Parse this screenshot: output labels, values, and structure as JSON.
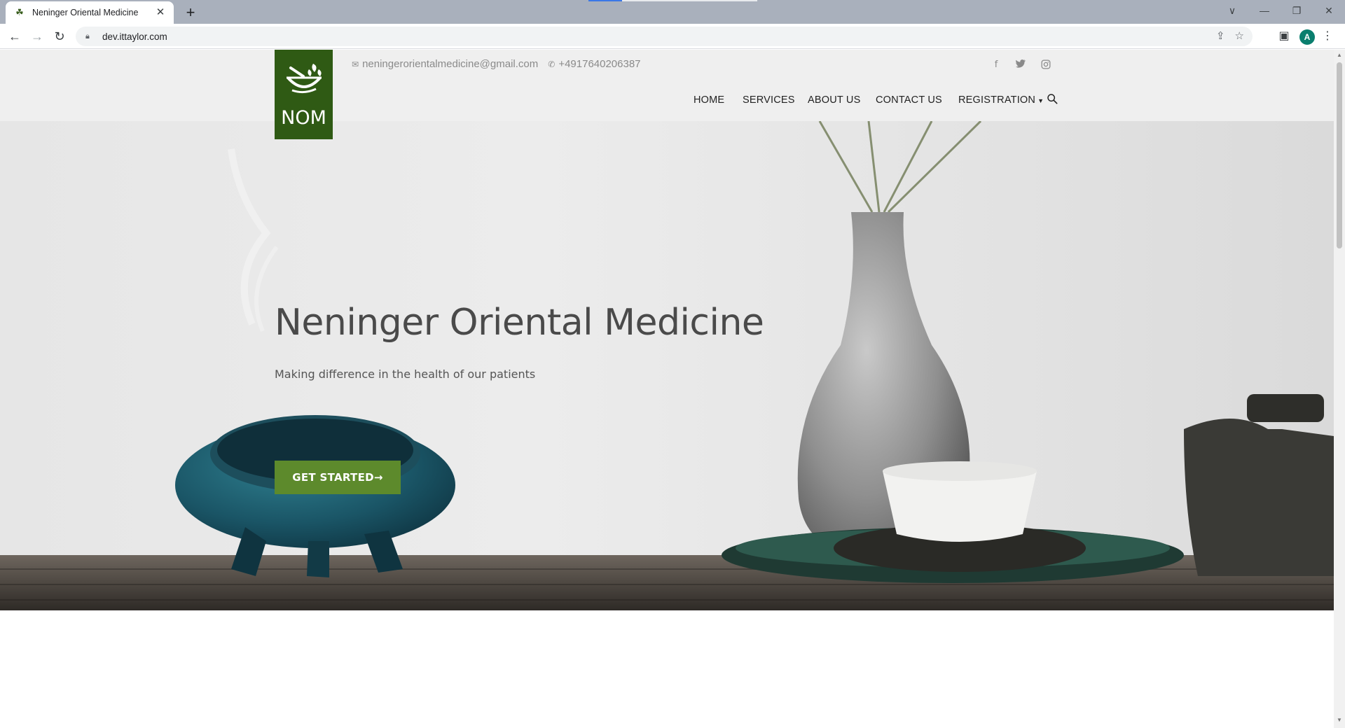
{
  "browser": {
    "tab_title": "Neninger Oriental Medicine",
    "favicon_icon": "mortar-leaf-icon",
    "new_tab_symbol": "+",
    "url": "dev.ittaylor.com",
    "avatar_letter": "A"
  },
  "site": {
    "logo_text": "NOM",
    "email": "neningerorientalmedicine@gmail.com",
    "phone": "+4917640206387",
    "nav": [
      {
        "label": "HOME"
      },
      {
        "label": "SERVICES"
      },
      {
        "label": "ABOUT US"
      },
      {
        "label": "CONTACT US"
      },
      {
        "label": "REGISTRATION"
      }
    ],
    "social": [
      "facebook-icon",
      "twitter-icon",
      "instagram-icon"
    ]
  },
  "hero": {
    "title": "Neninger Oriental Medicine",
    "subtitle": "Making difference in the health of our patients",
    "cta_label": "GET STARTED→"
  },
  "colors": {
    "brand_green": "#2f5a14",
    "cta_green": "#5d8a2c"
  }
}
